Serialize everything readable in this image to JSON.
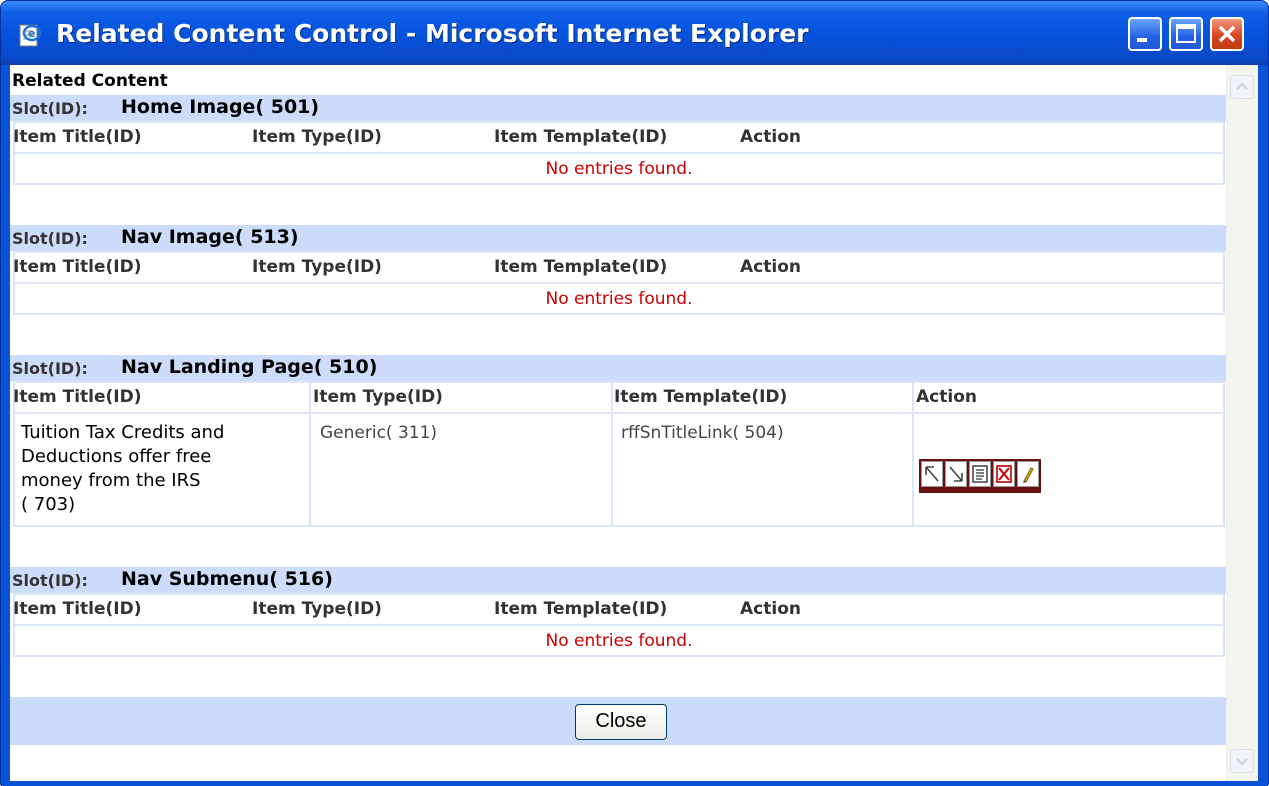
{
  "window": {
    "title": "Related Content Control - Microsoft Internet Explorer",
    "icon": "ie-page-icon",
    "controls": [
      "minimize-icon",
      "maximize-icon",
      "close-icon"
    ]
  },
  "page": {
    "heading": "Related Content",
    "slot_label": "Slot(ID):",
    "columns": {
      "title": "Item Title(ID)",
      "type": "Item Type(ID)",
      "template": "Item Template(ID)",
      "action": "Action"
    },
    "empty_message": "No entries found.",
    "slots": [
      {
        "name": "Home Image( 501)",
        "items": []
      },
      {
        "name": "Nav Image( 513)",
        "items": []
      },
      {
        "name": "Nav Landing Page( 510)",
        "items": [
          {
            "title_lines": [
              "Tuition Tax Credits and",
              "Deductions offer free",
              "money from the IRS",
              "( 703)"
            ],
            "type": "Generic( 311)",
            "template": "rffSnTitleLink( 504)",
            "actions": [
              "move-up-icon",
              "move-down-icon",
              "edit-properties-icon",
              "delete-icon",
              "edit-pencil-icon"
            ]
          }
        ]
      },
      {
        "name": "Nav Submenu( 516)",
        "items": []
      }
    ],
    "close_button": "Close"
  },
  "colors": {
    "titlebar": "#0552db",
    "slot_bar": "#ccdcfa",
    "empty_text": "#cc0000",
    "action_border": "#6b1010"
  }
}
